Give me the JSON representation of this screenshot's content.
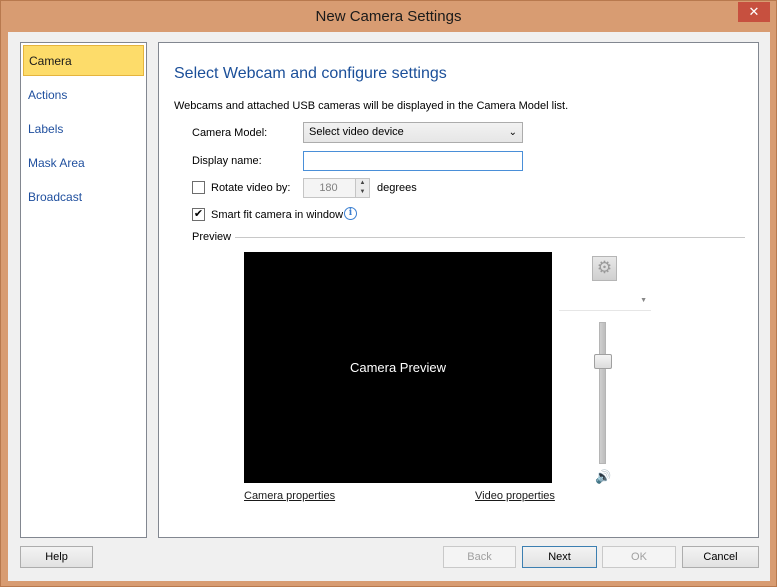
{
  "window": {
    "title": "New Camera Settings",
    "close_symbol": "✕"
  },
  "sidebar": {
    "items": [
      {
        "label": "Camera",
        "active": true
      },
      {
        "label": "Actions"
      },
      {
        "label": "Labels"
      },
      {
        "label": "Mask Area"
      },
      {
        "label": "Broadcast"
      }
    ]
  },
  "main": {
    "heading": "Select Webcam and configure settings",
    "description": "Webcams and attached USB cameras will be displayed in the Camera Model list.",
    "camera_model": {
      "label": "Camera Model:",
      "value": "Select video device"
    },
    "display_name": {
      "label": "Display name:",
      "value": ""
    },
    "rotate": {
      "label": "Rotate video by:",
      "value": "180",
      "unit": "degrees",
      "checked": false
    },
    "smart_fit": {
      "label": "Smart fit camera in window",
      "checked": true
    },
    "preview": {
      "label": "Preview",
      "placeholder": "Camera Preview",
      "camera_properties": "Camera properties",
      "video_properties": "Video properties"
    },
    "side_controls": {
      "settings_icon": "gear-icon",
      "volume_icon": "speaker-icon",
      "volume_level": 0.75
    }
  },
  "footer": {
    "help": "Help",
    "back": "Back",
    "next": "Next",
    "ok": "OK",
    "cancel": "Cancel"
  },
  "colors": {
    "window_frame": "#d89c72",
    "active_nav": "#fddc6a",
    "heading": "#1b4f99",
    "close_button": "#c7503f"
  }
}
